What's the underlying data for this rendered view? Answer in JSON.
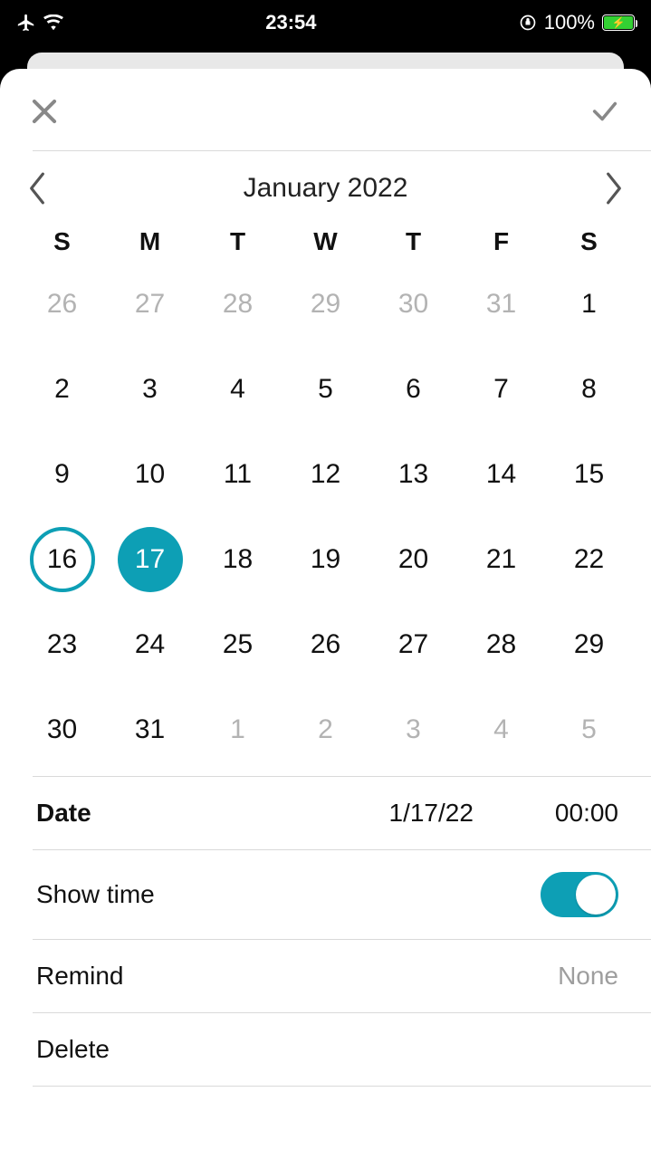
{
  "statusbar": {
    "time": "23:54",
    "battery_pct": "100%"
  },
  "colors": {
    "accent": "#0d9fb5"
  },
  "calendar": {
    "month_label": "January 2022",
    "day_headers": [
      "S",
      "M",
      "T",
      "W",
      "T",
      "F",
      "S"
    ],
    "today": 16,
    "selected": 17,
    "weeks": [
      [
        {
          "n": 26,
          "muted": true
        },
        {
          "n": 27,
          "muted": true
        },
        {
          "n": 28,
          "muted": true
        },
        {
          "n": 29,
          "muted": true
        },
        {
          "n": 30,
          "muted": true
        },
        {
          "n": 31,
          "muted": true
        },
        {
          "n": 1
        }
      ],
      [
        {
          "n": 2
        },
        {
          "n": 3
        },
        {
          "n": 4
        },
        {
          "n": 5
        },
        {
          "n": 6
        },
        {
          "n": 7
        },
        {
          "n": 8
        }
      ],
      [
        {
          "n": 9
        },
        {
          "n": 10
        },
        {
          "n": 11
        },
        {
          "n": 12
        },
        {
          "n": 13
        },
        {
          "n": 14
        },
        {
          "n": 15
        }
      ],
      [
        {
          "n": 16
        },
        {
          "n": 17
        },
        {
          "n": 18
        },
        {
          "n": 19
        },
        {
          "n": 20
        },
        {
          "n": 21
        },
        {
          "n": 22
        }
      ],
      [
        {
          "n": 23
        },
        {
          "n": 24
        },
        {
          "n": 25
        },
        {
          "n": 26
        },
        {
          "n": 27
        },
        {
          "n": 28
        },
        {
          "n": 29
        }
      ],
      [
        {
          "n": 30
        },
        {
          "n": 31
        },
        {
          "n": 1,
          "muted": true
        },
        {
          "n": 2,
          "muted": true
        },
        {
          "n": 3,
          "muted": true
        },
        {
          "n": 4,
          "muted": true
        },
        {
          "n": 5,
          "muted": true
        }
      ]
    ]
  },
  "options": {
    "date_label": "Date",
    "date_value": "1/17/22",
    "time_value": "00:00",
    "show_time_label": "Show time",
    "show_time_on": true,
    "remind_label": "Remind",
    "remind_value": "None",
    "delete_label": "Delete"
  }
}
